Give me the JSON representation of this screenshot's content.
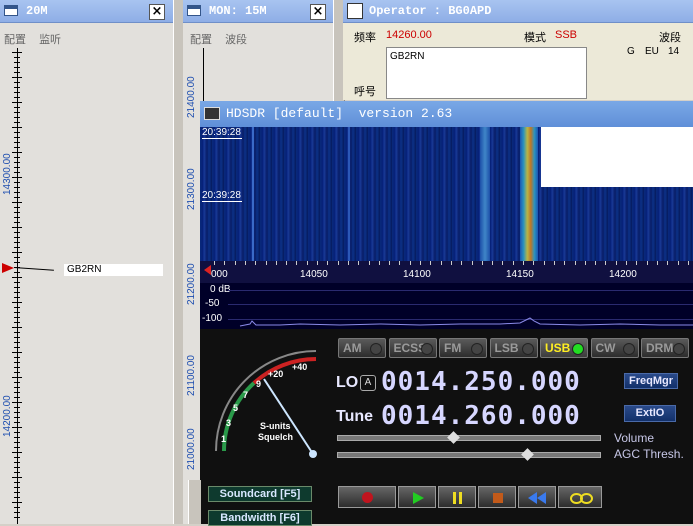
{
  "left_window": {
    "title": "20M",
    "menu": [
      "配置",
      "监听"
    ],
    "scale_labels": [
      "14300.00",
      "14200.00"
    ],
    "marker_callsign": "GB2RN"
  },
  "mid_window": {
    "title": "MON: 15M",
    "menu": [
      "配置",
      "波段"
    ],
    "scale_labels": [
      "21400.00",
      "21300.00",
      "21200.00",
      "21100.00",
      "21000.00"
    ]
  },
  "operator_window": {
    "title": "Operator : BG0APD",
    "freq_label": "频率",
    "freq_value": "14260.00",
    "mode_label": "模式",
    "mode_value": "SSB",
    "band_label": "波段",
    "callsign_value": "GB2RN",
    "callsign_label": "呼号",
    "info_g": "G",
    "info_eu": "EU",
    "info_14": "14"
  },
  "hdsdr": {
    "title": "HDSDR [default]  version 2.63",
    "times": [
      "20:39:28",
      "20:39:28"
    ],
    "freq_ticks": [
      "000",
      "14050",
      "14100",
      "14150",
      "14200"
    ],
    "db_labels": [
      "0 dB",
      "-50",
      "-100"
    ],
    "modes": [
      "AM",
      "ECSS",
      "FM",
      "LSB",
      "USB",
      "CW",
      "DRM"
    ],
    "active_mode": "USB",
    "lo_label": "LO",
    "lo_badge": "A",
    "lo_value": "0014.250.000",
    "tune_label": "Tune",
    "tune_value": "0014.260.000",
    "freqmgr": "FreqMgr",
    "extio": "ExtIO",
    "volume": "Volume",
    "agc": "AGC Thresh.",
    "smeter_labels": [
      "1",
      "3",
      "5",
      "7",
      "9",
      "+20",
      "+40"
    ],
    "s_units": "S-units",
    "squelch": "Squelch",
    "soundcard": "Soundcard [F5]",
    "bandwidth": "Bandwidth [F6]",
    "volume_level": 0.44,
    "agc_level": 0.72
  },
  "colors": {
    "titlebar": "#8eaee6",
    "active_led": "#22dd22",
    "usb_text": "#ffee22",
    "scale_blue": "#1f4fb0"
  }
}
